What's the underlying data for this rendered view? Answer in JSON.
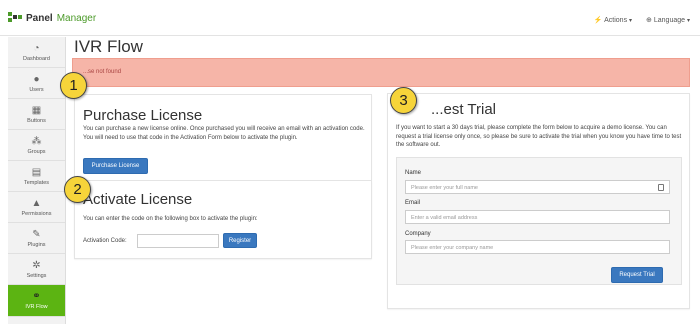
{
  "brand": {
    "title_bold": "Panel",
    "title_light": "Manager",
    "accent": "#4c9a2a"
  },
  "nav": {
    "actions": "Actions",
    "language": "Language"
  },
  "sidebar": {
    "items": [
      {
        "label": "Dashboard",
        "icon": "dashboard-icon"
      },
      {
        "label": "Users",
        "icon": "user-icon"
      },
      {
        "label": "Buttons",
        "icon": "grid-icon"
      },
      {
        "label": "Groups",
        "icon": "groups-icon"
      },
      {
        "label": "Templates",
        "icon": "templates-icon"
      },
      {
        "label": "Permissions",
        "icon": "warning-icon"
      },
      {
        "label": "Plugins",
        "icon": "plug-icon"
      },
      {
        "label": "Settings",
        "icon": "gear-icon"
      },
      {
        "label": "IVR Flow",
        "icon": "flow-icon",
        "active": true
      }
    ],
    "active_color": "#5cb412"
  },
  "page": {
    "title": "IVR Flow",
    "alert_text": "...se not found"
  },
  "purchase": {
    "heading": "Purchase License",
    "text": "You can purchase a new license online. Once purchased you will receive an email with an activation code. You will need to use that code in the Activation Form below to activate the plugin.",
    "button": "Purchase License"
  },
  "activate": {
    "heading": "Activate License",
    "text": "You can enter the code on the following box to activate the plugin:",
    "code_label": "Activation Code:",
    "register_button": "Register"
  },
  "trial": {
    "heading": "...est Trial",
    "text": "If you want to start a 30 days trial, please complete the form below to acquire a demo license. You can request a trial license only once, so please be sure to activate the trial when you know you have time to test the software out.",
    "name_label": "Name",
    "name_placeholder": "Please enter your full name",
    "email_label": "Email",
    "email_placeholder": "Enter a valid email address",
    "company_label": "Company",
    "company_placeholder": "Please enter your company name",
    "button": "Request Trial"
  },
  "badges": [
    "1",
    "2",
    "3"
  ],
  "colors": {
    "button": "#3a78bf",
    "alert_bg": "#f6b5a8",
    "badge": "#f6d43a"
  }
}
